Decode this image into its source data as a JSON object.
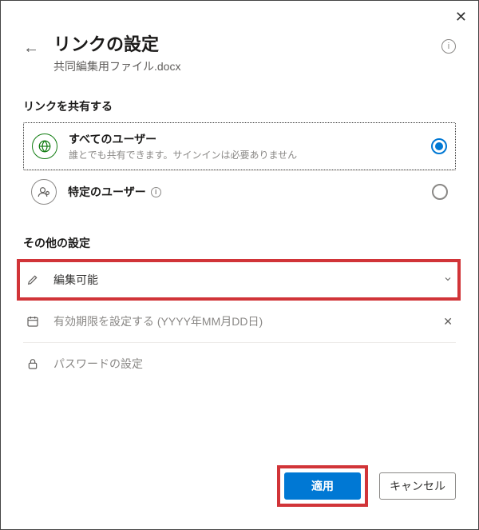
{
  "header": {
    "title": "リンクの設定",
    "subtitle": "共同編集用ファイル.docx"
  },
  "share": {
    "label": "リンクを共有する",
    "anyone": {
      "title": "すべてのユーザー",
      "desc": "誰とでも共有できます。サインインは必要ありません"
    },
    "specific": {
      "title": "特定のユーザー"
    }
  },
  "other": {
    "label": "その他の設定",
    "edit": "編集可能",
    "expiry_placeholder": "有効期限を設定する (YYYY年MM月DD日)",
    "password_placeholder": "パスワードの設定"
  },
  "buttons": {
    "apply": "適用",
    "cancel": "キャンセル"
  }
}
